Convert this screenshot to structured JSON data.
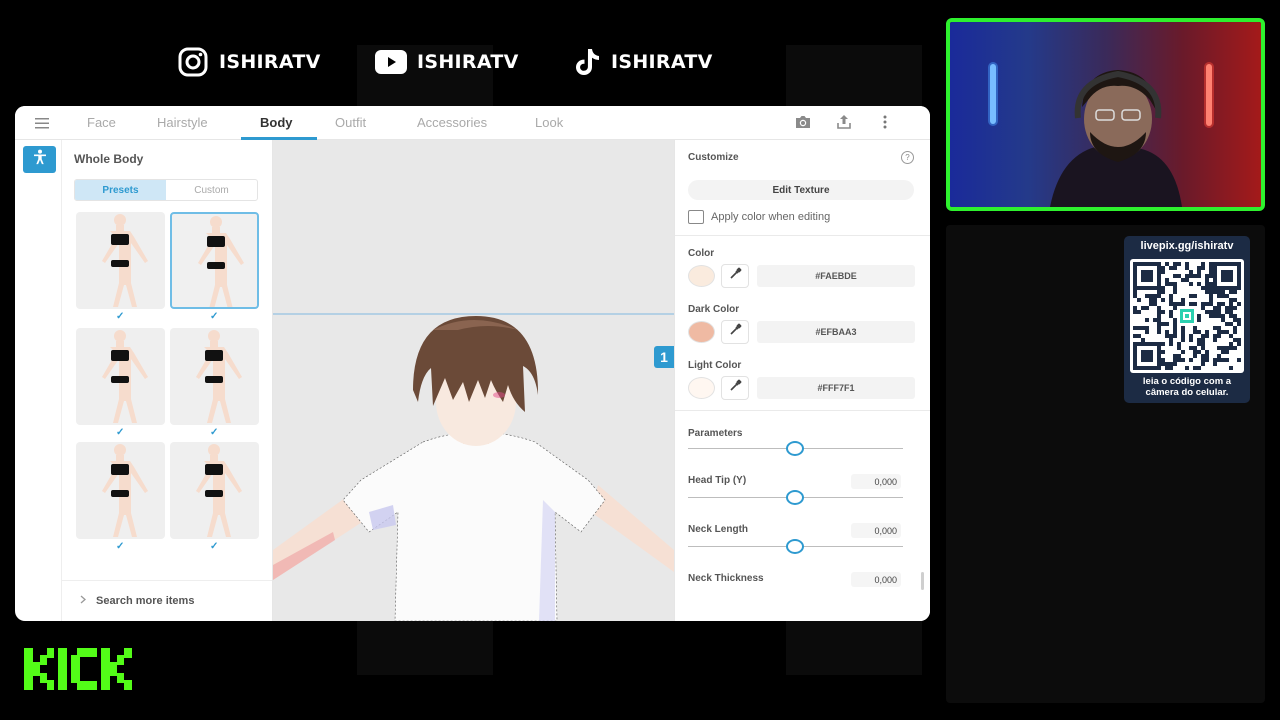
{
  "socials": [
    {
      "platform": "instagram-icon",
      "handle": "ISHIRATV"
    },
    {
      "platform": "youtube-icon",
      "handle": "ISHIRATV"
    },
    {
      "platform": "tiktok-icon",
      "handle": "ISHIRATV"
    }
  ],
  "app": {
    "tabs": [
      "Face",
      "Hairstyle",
      "Body",
      "Outfit",
      "Accessories",
      "Look"
    ],
    "active_tab": "Body",
    "left_panel": {
      "title": "Whole Body",
      "segments": [
        "Presets",
        "Custom"
      ],
      "active_segment": "Presets",
      "search_more": "Search more items",
      "check_mark": "✓"
    },
    "viewport": {
      "badge": "1"
    },
    "right_panel": {
      "customize_label": "Customize",
      "help_icon": "?",
      "edit_texture": "Edit Texture",
      "apply_color": "Apply color when editing",
      "color_label": "Color",
      "color_hex": "#FAEBDE",
      "dark_color_label": "Dark Color",
      "dark_color_hex": "#EFBAA3",
      "light_color_label": "Light Color",
      "light_color_hex": "#FFF7F1",
      "parameters_label": "Parameters",
      "head_tip_label": "Head Tip (Y)",
      "head_tip_value": "0,000",
      "neck_length_label": "Neck Length",
      "neck_length_value": "0,000",
      "neck_thickness_label": "Neck Thickness",
      "neck_thickness_value": "0,000"
    }
  },
  "qr": {
    "url": "livepix.gg/ishiratv",
    "caption_line1": "leia o código com a",
    "caption_line2": "câmera do celular."
  },
  "kick_logo": "KICK",
  "colors": {
    "accent": "#2e9ad0",
    "cam_border": "#2ef12e",
    "kick_green": "#53fc18"
  }
}
